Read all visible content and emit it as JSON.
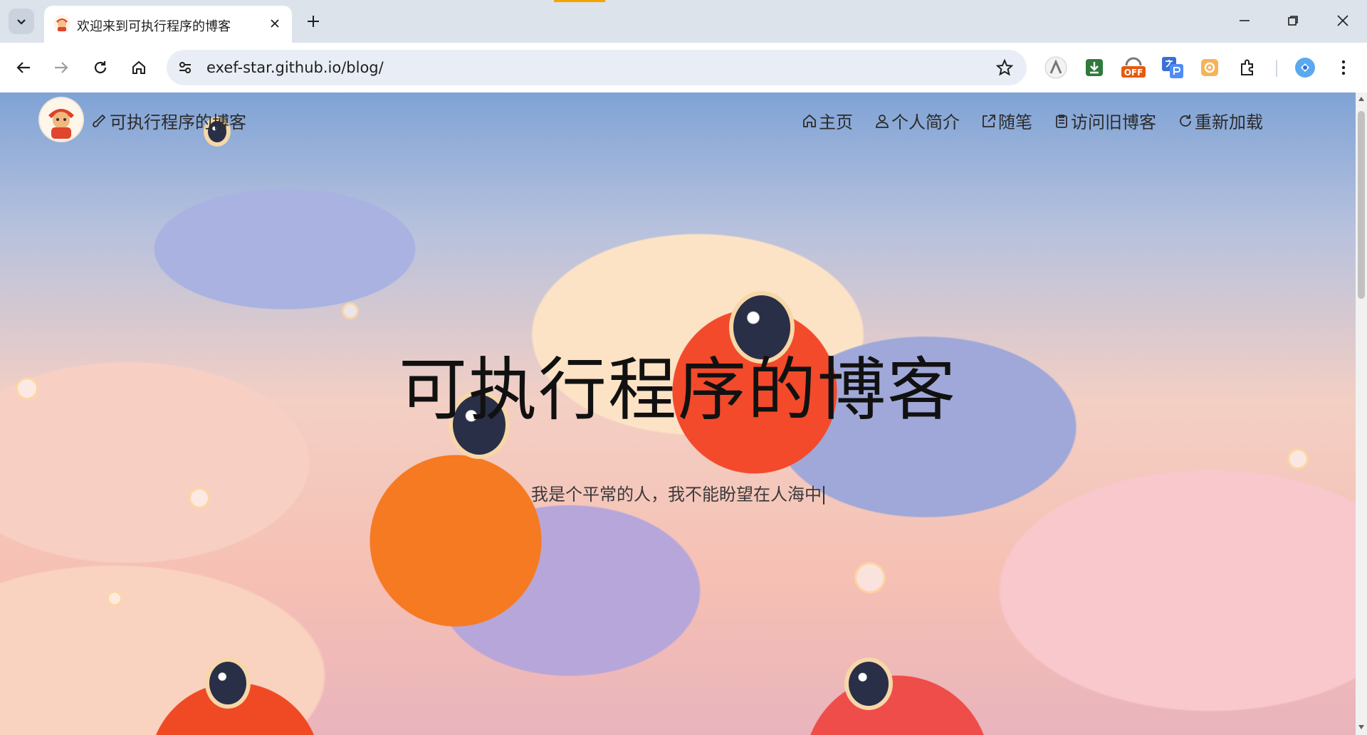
{
  "browser": {
    "tab": {
      "title": "欢迎来到可执行程序的博客"
    },
    "url": "exef-star.github.io/blog/",
    "extensions": [
      "immersive-translate-icon",
      "download-icon",
      "off-badge-icon",
      "translate-icon",
      "screenshot-icon",
      "puzzle-extensions-icon",
      "profile-icon",
      "more-menu-icon"
    ],
    "extension_off_label": "OFF"
  },
  "site": {
    "brand": "可执行程序的博客",
    "nav": [
      {
        "label": "主页",
        "icon": "home-icon"
      },
      {
        "label": "个人简介",
        "icon": "user-icon"
      },
      {
        "label": "随笔",
        "icon": "external-link-icon"
      },
      {
        "label": "访问旧博客",
        "icon": "clipboard-icon"
      },
      {
        "label": "重新加载",
        "icon": "reload-icon"
      }
    ],
    "hero": {
      "title": "可执行程序的博客",
      "subtitle": "我是个平常的人，我不能盼望在人海中"
    }
  },
  "colors": {
    "tabstrip": "#dde3ea",
    "omnibox": "#e9eef6",
    "accent": "#f4a300"
  }
}
